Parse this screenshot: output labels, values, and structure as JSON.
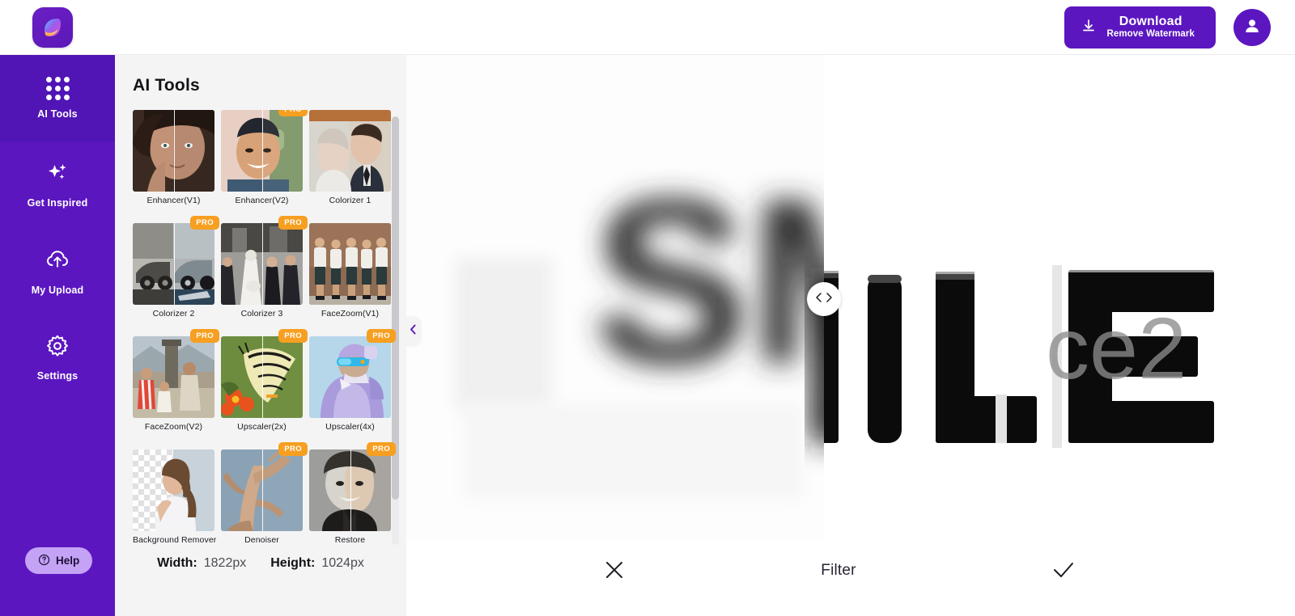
{
  "header": {
    "logo_icon": "app-logo-leaf-icon",
    "download": {
      "icon": "download-icon",
      "main_label": "Download",
      "sub_label": "Remove Watermark"
    },
    "account": {
      "icon": "user-avatar-icon"
    }
  },
  "sidebar": {
    "items": [
      {
        "label": "AI Tools",
        "icon": "grid-dots-icon",
        "active": true
      },
      {
        "label": "Get Inspired",
        "icon": "sparkle-icon",
        "active": false
      },
      {
        "label": "My Upload",
        "icon": "cloud-upload-icon",
        "active": false
      },
      {
        "label": "Settings",
        "icon": "gear-icon",
        "active": false
      }
    ],
    "help": {
      "label": "Help",
      "icon": "question-circle-icon"
    }
  },
  "tools_panel": {
    "title": "AI Tools",
    "collapse_icon": "chevron-left-icon",
    "pro_badge": "PRO",
    "tools": [
      {
        "label": "Enhancer(V1)",
        "pro": false
      },
      {
        "label": "Enhancer(V2)",
        "pro": true
      },
      {
        "label": "Colorizer 1",
        "pro": false
      },
      {
        "label": "Colorizer 2",
        "pro": true
      },
      {
        "label": "Colorizer 3",
        "pro": true
      },
      {
        "label": "FaceZoom(V1)",
        "pro": false
      },
      {
        "label": "FaceZoom(V2)",
        "pro": true
      },
      {
        "label": "Upscaler(2x)",
        "pro": true
      },
      {
        "label": "Upscaler(4x)",
        "pro": true
      },
      {
        "label": "Background Remover",
        "pro": false
      },
      {
        "label": "Denoiser",
        "pro": true
      },
      {
        "label": "Restore",
        "pro": true
      }
    ],
    "dimensions": {
      "width_label": "Width:",
      "width_value": "1822px",
      "height_label": "Height:",
      "height_value": "1024px"
    }
  },
  "canvas": {
    "image_text_before": "SM",
    "image_text_after": "ILE",
    "watermark": "ce2",
    "slider_handle_icon": "left-right-chevrons-icon",
    "bottom_bar": {
      "cancel_icon": "close-x-icon",
      "title": "Filter",
      "confirm_icon": "check-icon"
    }
  },
  "colors": {
    "brand_purple": "#5b16c0",
    "rail_active": "#5114b5",
    "pro_orange": "#f79f21",
    "help_lilac": "#c4a2f5",
    "panel_bg": "#f4f4f5"
  }
}
